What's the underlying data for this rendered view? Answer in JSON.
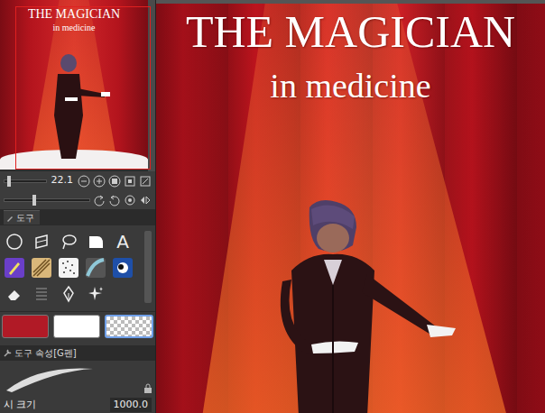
{
  "navigator": {
    "title": "THE MAGICIAN",
    "subtitle": "in medicine"
  },
  "zoom": {
    "value": "22.1",
    "level": 0.1
  },
  "rotate": {
    "level": 0.35
  },
  "tool_tab": {
    "label": "도구"
  },
  "text_tool": {
    "glyph": "A"
  },
  "colors": [
    {
      "kind": "solid",
      "color": "#b11a26",
      "selected": false
    },
    {
      "kind": "solid",
      "color": "#ffffff",
      "selected": false
    },
    {
      "kind": "transparent",
      "color": "#ffffff",
      "selected": true
    }
  ],
  "tool_property": {
    "title": "도구 속성[G펜]"
  },
  "brush_size": {
    "label": "시 크기",
    "value": "1000.0"
  },
  "canvas": {
    "title": "THE MAGICIAN",
    "subtitle": "in medicine"
  }
}
